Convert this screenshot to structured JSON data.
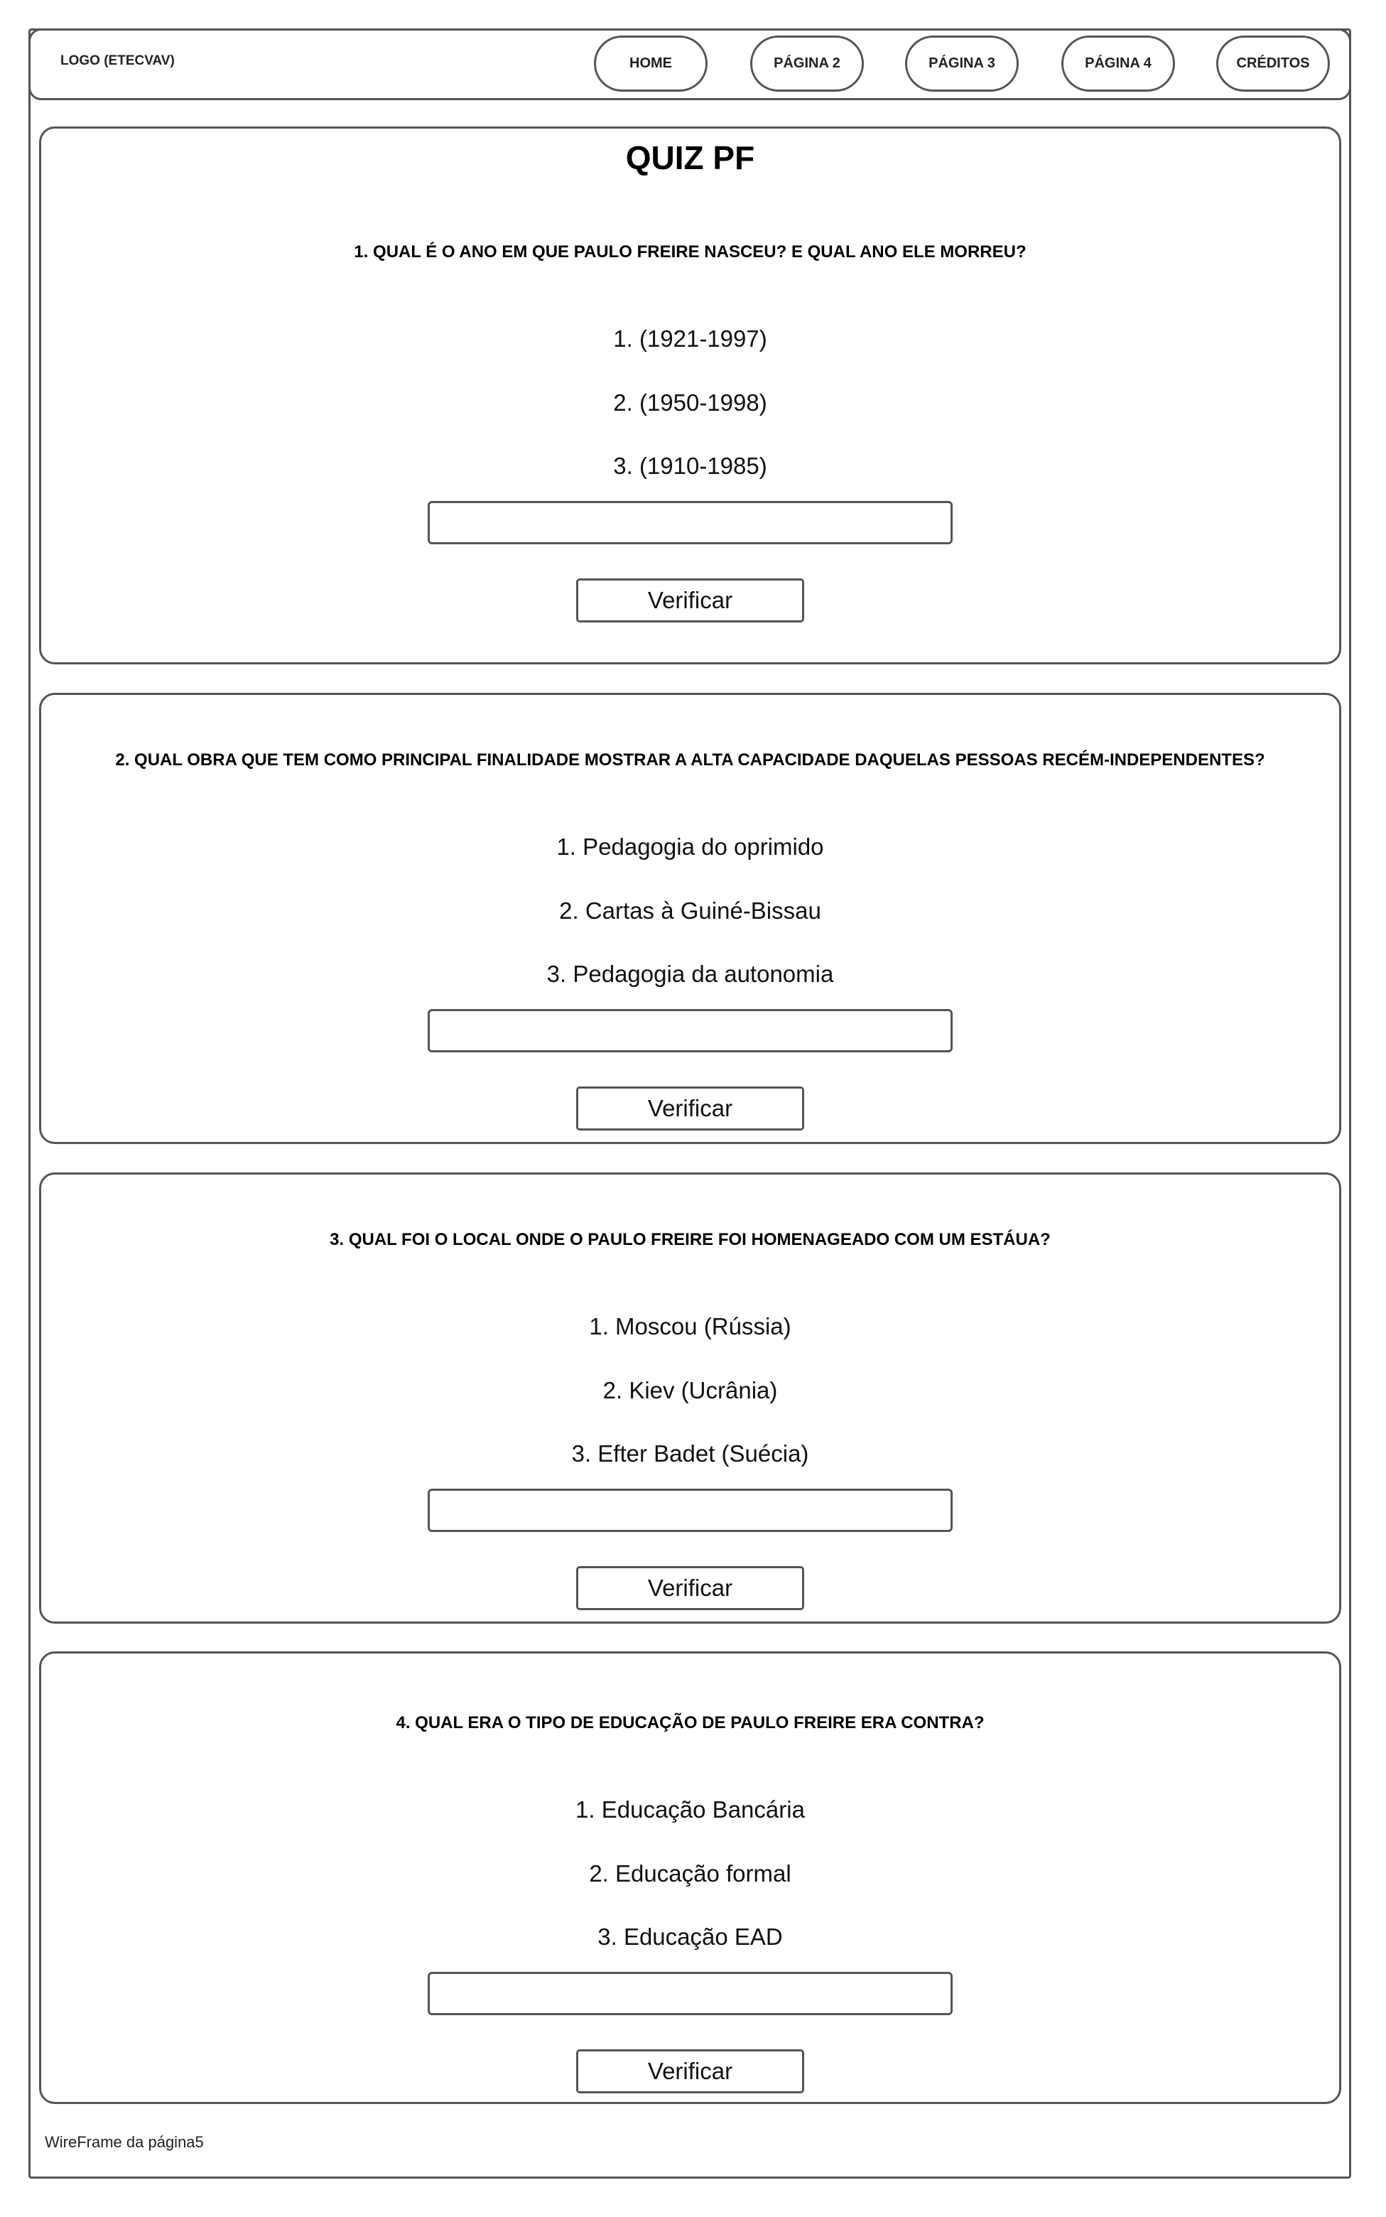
{
  "header": {
    "logo": "LOGO (ETECVAV)",
    "nav": [
      "HOME",
      "PÁGINA 2",
      "PÁGINA 3",
      "PÁGINA 4",
      "CRÉDITOS"
    ]
  },
  "quiz": {
    "title": "QUIZ PF",
    "questions": [
      {
        "text": "1. QUAL É O ANO EM QUE PAULO FREIRE NASCEU? E QUAL ANO ELE MORREU?",
        "options": [
          "1. (1921-1997)",
          "2. (1950-1998)",
          "3. (1910-1985)"
        ],
        "answer_value": "",
        "button_label": "Verificar"
      },
      {
        "text": "2. QUAL OBRA QUE TEM COMO PRINCIPAL FINALIDADE MOSTRAR A ALTA CAPACIDADE DAQUELAS PESSOAS RECÉM-INDEPENDENTES?",
        "options": [
          "1. Pedagogia do oprimido",
          "2. Cartas à Guiné-Bissau",
          "3. Pedagogia da autonomia"
        ],
        "answer_value": "",
        "button_label": "Verificar"
      },
      {
        "text": "3. QUAL FOI O LOCAL ONDE O PAULO FREIRE FOI HOMENAGEADO COM UM ESTÁUA?",
        "options": [
          "1. Moscou (Rússia)",
          "2. Kiev (Ucrânia)",
          "3. Efter Badet (Suécia)"
        ],
        "answer_value": "",
        "button_label": "Verificar"
      },
      {
        "text": "4. QUAL ERA O TIPO DE EDUCAÇÃO DE PAULO FREIRE ERA CONTRA?",
        "options": [
          "1. Educação Bancária",
          "2. Educação formal",
          "3. Educação EAD"
        ],
        "answer_value": "",
        "button_label": "Verificar"
      }
    ]
  },
  "footer": {
    "caption": "WireFrame da página5"
  },
  "colors": {
    "border": "#555555",
    "background": "#ffffff",
    "text": "#111111"
  }
}
